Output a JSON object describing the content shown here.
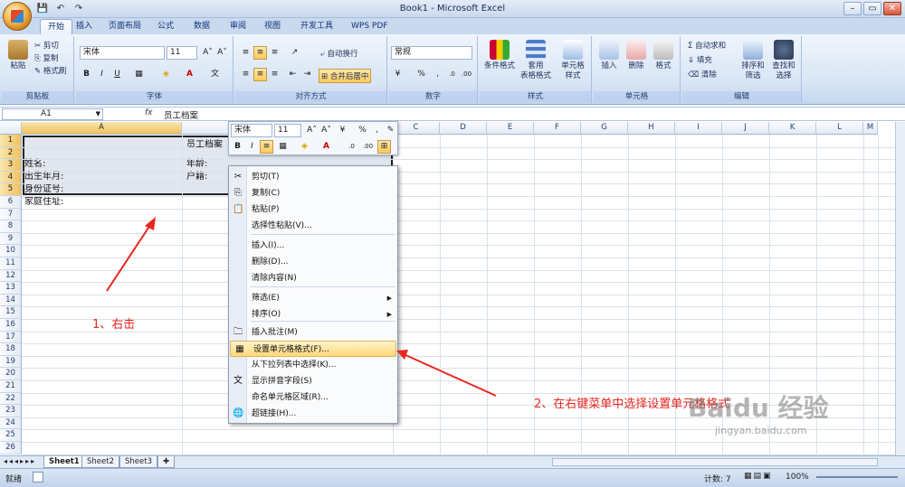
{
  "window": {
    "title": "Book1 - Microsoft Excel"
  },
  "qat": {
    "save": "💾",
    "undo": "↶",
    "redo": "↷"
  },
  "tabs": [
    "开始",
    "插入",
    "页面布局",
    "公式",
    "数据",
    "审阅",
    "视图",
    "开发工具",
    "WPS PDF"
  ],
  "ribbon": {
    "clipboard": {
      "label": "剪贴板",
      "paste": "粘贴",
      "cut": "剪切",
      "copy": "复制",
      "format_painter": "格式刷"
    },
    "font": {
      "label": "字体",
      "name": "宋体",
      "size": "11",
      "bold": "B",
      "italic": "I",
      "underline": "U",
      "grow": "A˄",
      "shrink": "A˅"
    },
    "alignment": {
      "label": "对齐方式",
      "wrap": "自动换行",
      "merge": "合并后居中"
    },
    "number": {
      "label": "数字",
      "format": "常规",
      "percent": "%",
      "comma": ","
    },
    "styles": {
      "label": "样式",
      "conditional": "条件格式",
      "table": "套用\n表格格式",
      "cell": "单元格\n样式"
    },
    "cells": {
      "label": "单元格",
      "insert": "插入",
      "delete": "删除",
      "format": "格式"
    },
    "editing": {
      "label": "编辑",
      "autosum": "Σ 自动求和",
      "fill": "填充",
      "clear": "清除",
      "sort": "排序和\n筛选",
      "find": "查找和\n选择"
    }
  },
  "formula_bar": {
    "name_box": "A1",
    "fx": "fx",
    "content": "员工档案"
  },
  "columns": [
    "A",
    "B",
    "C",
    "D",
    "E",
    "F",
    "G",
    "H",
    "I",
    "J",
    "K",
    "L",
    "M"
  ],
  "rows": [
    "1",
    "2",
    "3",
    "4",
    "5",
    "6",
    "7",
    "8",
    "9",
    "10",
    "11",
    "12",
    "13",
    "14",
    "15",
    "16",
    "17",
    "18",
    "19",
    "20",
    "21",
    "22",
    "23",
    "24",
    "25",
    "26"
  ],
  "cells": {
    "r1": "员工档案",
    "r2a": "姓名:",
    "r2b": "年龄:",
    "r3a": "出生年月:",
    "r3b": "户籍:",
    "r4a": "身份证号:",
    "r5a": "家庭住址:"
  },
  "mini_toolbar": {
    "font": "宋体",
    "size": "11",
    "percent": "%",
    "comma": ","
  },
  "context_menu": {
    "items": [
      {
        "label": "剪切(T)",
        "icon": "✂"
      },
      {
        "label": "复制(C)",
        "icon": "⎘"
      },
      {
        "label": "粘贴(P)",
        "icon": "📋"
      },
      {
        "label": "选择性粘贴(V)...",
        "icon": ""
      },
      {
        "label": "插入(I)...",
        "icon": ""
      },
      {
        "label": "删除(D)...",
        "icon": ""
      },
      {
        "label": "清除内容(N)",
        "icon": ""
      },
      {
        "label": "筛选(E)",
        "icon": ""
      },
      {
        "label": "排序(O)",
        "icon": ""
      },
      {
        "label": "插入批注(M)",
        "icon": "🗀"
      },
      {
        "label": "设置单元格格式(F)...",
        "icon": "▦"
      },
      {
        "label": "从下拉列表中选择(K)...",
        "icon": ""
      },
      {
        "label": "显示拼音字段(S)",
        "icon": "文"
      },
      {
        "label": "命名单元格区域(R)...",
        "icon": ""
      },
      {
        "label": "超链接(H)...",
        "icon": "🌐"
      }
    ]
  },
  "sheets": [
    "Sheet1",
    "Sheet2",
    "Sheet3"
  ],
  "status": {
    "ready": "就绪",
    "count": "计数: 7",
    "zoom": "100%"
  },
  "annotations": {
    "step1": "1、右击",
    "step2": "2、在右键菜单中选择设置单元格格式"
  },
  "watermark": {
    "brand": "Baidu 经验",
    "url": "jingyan.baidu.com"
  }
}
